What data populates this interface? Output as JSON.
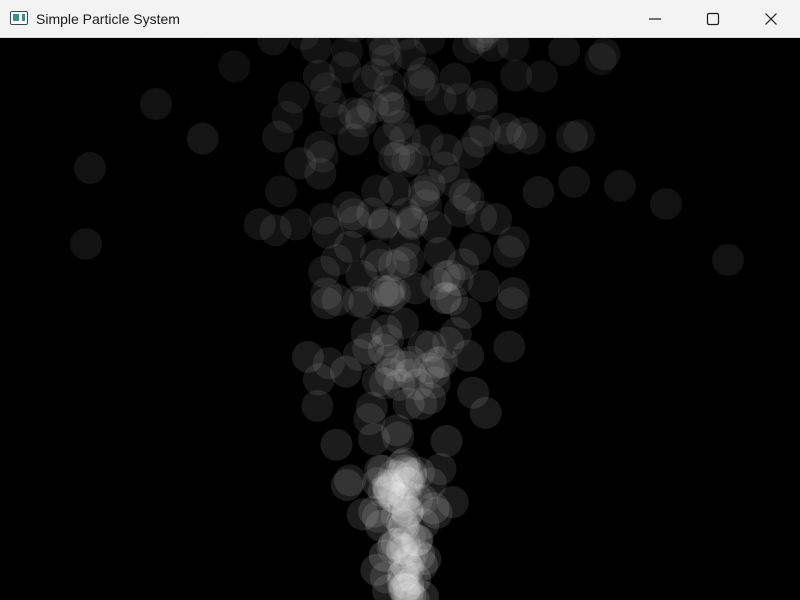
{
  "window": {
    "title": "Simple Particle System",
    "icon": "app-window-icon",
    "controls": {
      "minimize_icon": "minimize-icon",
      "maximize_icon": "maximize-icon",
      "close_icon": "close-icon"
    }
  },
  "scene": {
    "background_color": "#000000",
    "particle_color": "#ffffff"
  }
}
